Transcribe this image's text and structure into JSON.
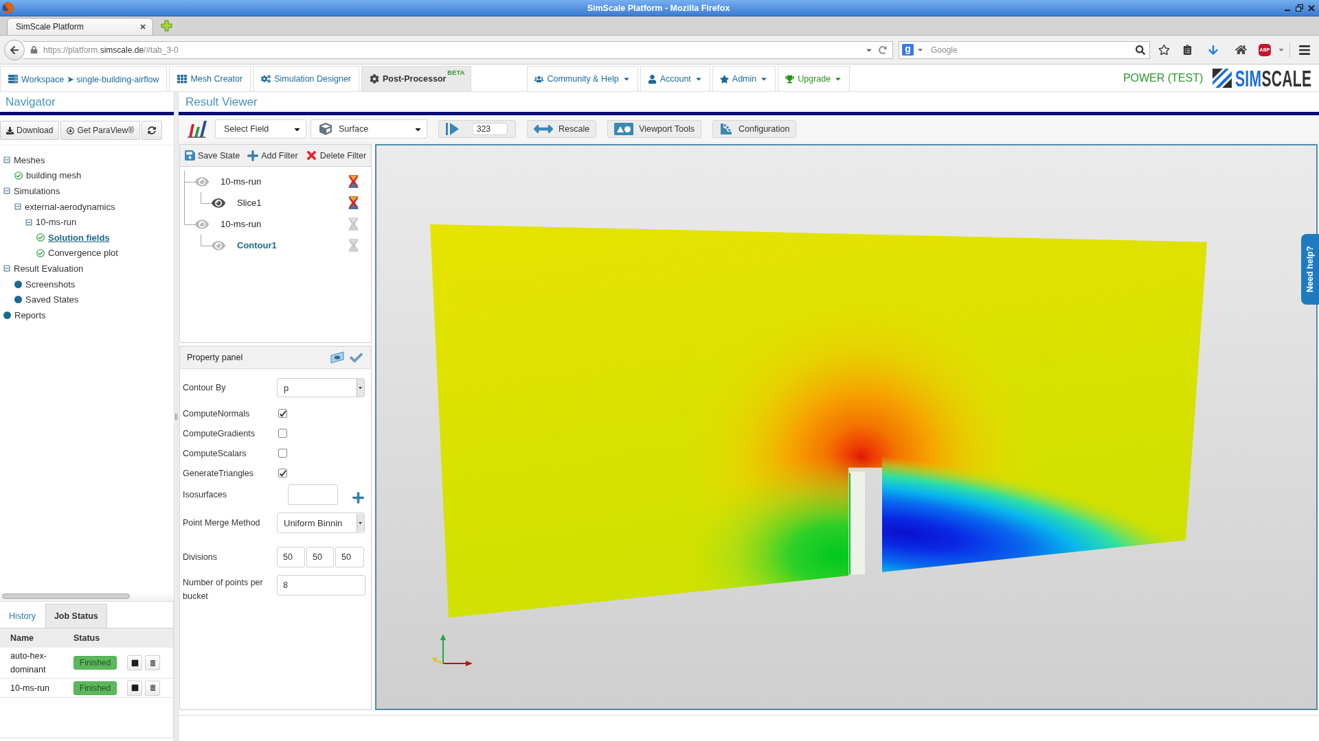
{
  "browser": {
    "window_title": "SimScale Platform - Mozilla Firefox",
    "tabs": [
      {
        "label": "SimScale Platform",
        "selected": true
      }
    ],
    "url": {
      "start": "https://platform.",
      "domain": "simscale.de",
      "end": "/#tab_3-0"
    },
    "search": {
      "engine_badge": "g",
      "placeholder": "Google"
    },
    "addon_badge": "ABP"
  },
  "app_nav": {
    "tabs": [
      {
        "label": "Workspace ➤ single-building-airflow",
        "selected": false
      },
      {
        "label": "Mesh Creator",
        "selected": false
      },
      {
        "label": "Simulation Designer",
        "selected": false
      },
      {
        "label": "Post-Processor",
        "selected": true,
        "badge": "BETA"
      }
    ],
    "menus": [
      {
        "label": "Community & Help",
        "color": "#1d6a9a"
      },
      {
        "label": "Account",
        "color": "#1d6a9a"
      },
      {
        "label": "Admin",
        "color": "#1d6a9a"
      },
      {
        "label": "Upgrade",
        "color": "#2a8f1e"
      }
    ],
    "plan": "POWER (TEST)",
    "logo": {
      "first": "SIM",
      "second": "SCALE"
    }
  },
  "navigator": {
    "title": "Navigator",
    "buttons": [
      "Download",
      "Get ParaView®"
    ],
    "tree": [
      {
        "kind": "group",
        "label": "Meshes",
        "expanded": true,
        "selected": false,
        "children": [
          {
            "kind": "done",
            "label": "building mesh",
            "selected": false
          }
        ]
      },
      {
        "kind": "group",
        "label": "Simulations",
        "expanded": true,
        "selected": false,
        "children": [
          {
            "kind": "group",
            "label": "external-aerodynamics",
            "expanded": true,
            "selected": false,
            "children": [
              {
                "kind": "group",
                "label": "10-ms-run",
                "expanded": true,
                "selected": false,
                "children": [
                  {
                    "kind": "done",
                    "label": "Solution fields",
                    "selected": true
                  },
                  {
                    "kind": "done",
                    "label": "Convergence plot",
                    "selected": false
                  }
                ]
              }
            ]
          }
        ]
      },
      {
        "kind": "group",
        "label": "Result Evaluation",
        "expanded": true,
        "selected": false,
        "children": [
          {
            "kind": "item",
            "label": "Screenshots",
            "selected": false
          },
          {
            "kind": "item",
            "label": "Saved States",
            "selected": false
          }
        ]
      },
      {
        "kind": "item",
        "label": "Reports",
        "selected": false
      }
    ]
  },
  "jobs_panel": {
    "tabs": [
      {
        "label": "History",
        "selected": false
      },
      {
        "label": "Job Status",
        "selected": true
      }
    ],
    "columns": [
      "Name",
      "Status"
    ],
    "rows": [
      {
        "name": "auto-hex-dominant",
        "status": "Finished"
      },
      {
        "name": "10-ms-run",
        "status": "Finished"
      }
    ]
  },
  "result_viewer": {
    "title": "Result Viewer",
    "toolbar": {
      "field": "Select Field",
      "representation": "Surface",
      "timestep": "323",
      "actions": [
        "Rescale",
        "Viewport Tools",
        "Configuration"
      ]
    },
    "filter_actions": [
      "Save State",
      "Add Filter",
      "Delete Filter"
    ],
    "pipeline": [
      {
        "label": "10-ms-run",
        "visible": false,
        "deletable": true,
        "selected": false,
        "children": [
          {
            "label": "Slice1",
            "visible": true,
            "deletable": true,
            "selected": false
          }
        ]
      },
      {
        "label": "10-ms-run",
        "visible": false,
        "deletable": false,
        "selected": false,
        "children": [
          {
            "label": "Contour1",
            "visible": false,
            "deletable": false,
            "selected": true
          }
        ]
      }
    ],
    "property_panel": {
      "title": "Property panel",
      "fields": [
        {
          "kind": "select",
          "label": "Contour By",
          "value": "p"
        },
        {
          "kind": "checkbox",
          "label": "ComputeNormals",
          "checked": true
        },
        {
          "kind": "checkbox",
          "label": "ComputeGradients",
          "checked": false
        },
        {
          "kind": "checkbox",
          "label": "ComputeScalars",
          "checked": false
        },
        {
          "kind": "checkbox",
          "label": "GenerateTriangles",
          "checked": true
        },
        {
          "kind": "list",
          "label": "Isosurfaces"
        },
        {
          "kind": "select",
          "label": "Point Merge Method",
          "value": "Uniform Binnin"
        },
        {
          "kind": "vector",
          "label": "Divisions",
          "values": [
            "50",
            "50",
            "50"
          ]
        },
        {
          "kind": "text",
          "label": "Number of points per bucket",
          "value": "8"
        }
      ]
    },
    "help_tab": "Need help?"
  }
}
